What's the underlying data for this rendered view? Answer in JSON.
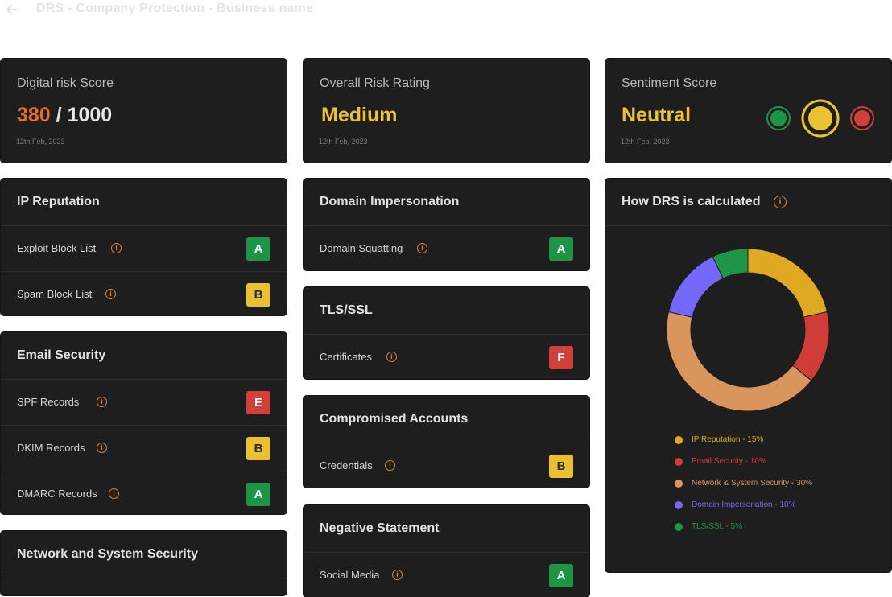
{
  "header": {
    "title": "DRS - Company Protection - Business name"
  },
  "scores": {
    "digital_risk": {
      "label": "Digital risk Score",
      "value": "380",
      "separator": " / ",
      "max": "1000",
      "date": "12th Feb, 2023"
    },
    "overall_risk": {
      "label": "Overall Risk Rating",
      "value": "Medium",
      "date": "12th Feb, 2023"
    },
    "sentiment": {
      "label": "Sentiment Score",
      "value": "Neutral",
      "date": "12th Feb, 2023",
      "selected": "neutral"
    }
  },
  "sections": {
    "ip_reputation": {
      "title": "IP Reputation",
      "rows": [
        {
          "label": "Exploit Block List",
          "grade": "A"
        },
        {
          "label": "Spam Block List",
          "grade": "B"
        }
      ]
    },
    "email_security": {
      "title": "Email Security",
      "rows": [
        {
          "label": "SPF Records",
          "grade": "E"
        },
        {
          "label": "DKIM Records",
          "grade": "B"
        },
        {
          "label": "DMARC Records",
          "grade": "A"
        }
      ]
    },
    "network_security": {
      "title": "Network and System Security"
    },
    "domain_impersonation": {
      "title": "Domain Impersonation",
      "rows": [
        {
          "label": "Domain Squatting",
          "grade": "A"
        }
      ]
    },
    "tls_ssl": {
      "title": "TLS/SSL",
      "rows": [
        {
          "label": "Certificates",
          "grade": "F"
        }
      ]
    },
    "compromised_accounts": {
      "title": "Compromised Accounts",
      "rows": [
        {
          "label": "Credentials",
          "grade": "B"
        }
      ]
    },
    "negative_statement": {
      "title": "Negative Statement",
      "rows": [
        {
          "label": "Social Media",
          "grade": "A"
        }
      ]
    }
  },
  "grade_colors": {
    "A": "#1e9447",
    "B": "#e8c032",
    "E": "#d13f3a",
    "F": "#d13f3a"
  },
  "chart": {
    "title": "How DRS is calculated"
  },
  "chart_data": {
    "type": "pie",
    "donut": true,
    "slices": [
      {
        "name": "IP Reputation - 15%",
        "value": 15,
        "color": "#e0a924"
      },
      {
        "name": "Email Security - 10%",
        "value": 10,
        "color": "#d03c38"
      },
      {
        "name": "Network & System Security - 30%",
        "value": 30,
        "color": "#d9955c"
      },
      {
        "name": "Domain Impersonation - 10%",
        "value": 10,
        "color": "#7567fa"
      },
      {
        "name": "TLS/SSL - 5%",
        "value": 5,
        "color": "#1f9547"
      }
    ],
    "legend_position": "bottom"
  }
}
